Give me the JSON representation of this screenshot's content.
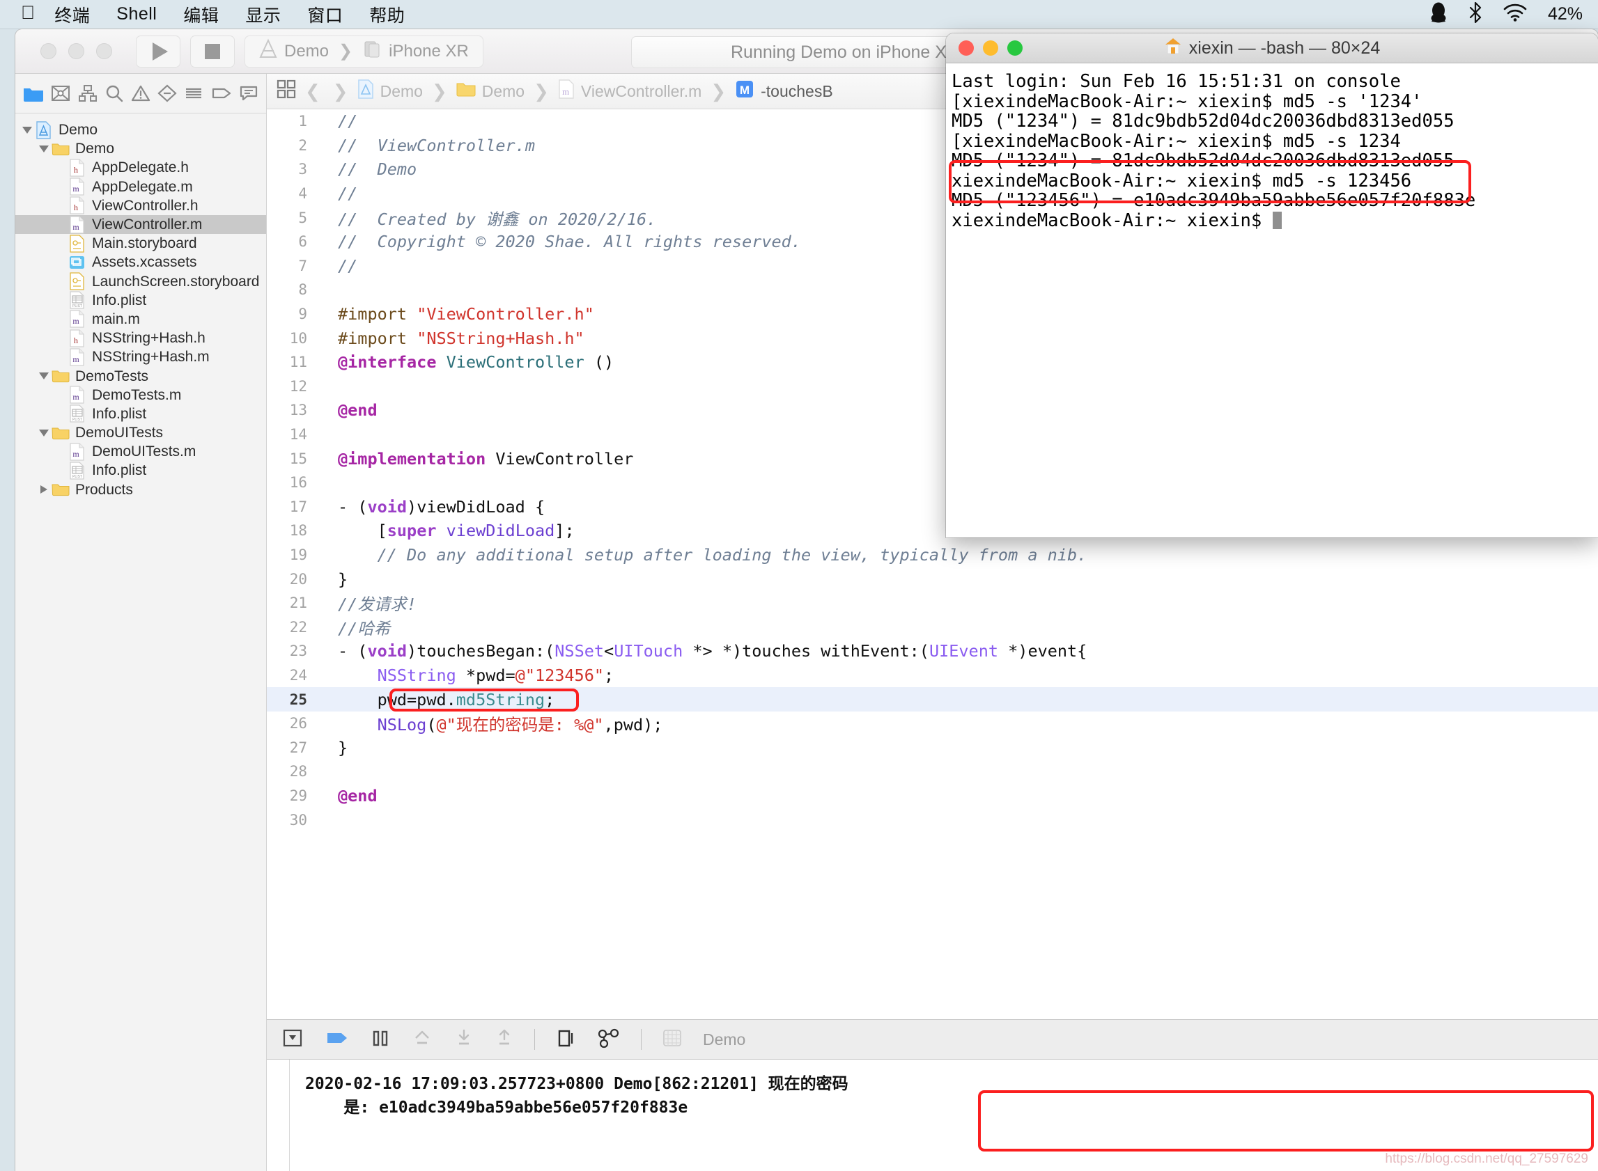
{
  "menubar": {
    "apple_icon": "apple-logo-icon",
    "items": [
      "终端",
      "Shell",
      "编辑",
      "显示",
      "窗口",
      "帮助"
    ],
    "right": {
      "qq_icon": "penguin-icon",
      "bluetooth_icon": "bluetooth-icon",
      "wifi_icon": "wifi-icon",
      "battery": "42%"
    }
  },
  "xcode": {
    "toolbar": {
      "run_icon": "play-icon",
      "stop_icon": "stop-icon",
      "scheme_app": "Demo",
      "scheme_device": "iPhone XR",
      "status": "Running Demo on iPhone XR"
    },
    "navigator": {
      "tabs": [
        "folder-icon",
        "warning-crossed-icon",
        "hierarchy-icon",
        "search-icon",
        "issue-warning-icon",
        "minus-diamond-icon",
        "list-icon",
        "tag-icon",
        "comment-icon"
      ],
      "tree": [
        {
          "label": "Demo",
          "indent": 0,
          "icon": "xcode-project-icon",
          "twisty": "open"
        },
        {
          "label": "Demo",
          "indent": 1,
          "icon": "folder-yellow-icon",
          "twisty": "open"
        },
        {
          "label": "AppDelegate.h",
          "indent": 2,
          "icon": "header-file-icon",
          "twisty": "none"
        },
        {
          "label": "AppDelegate.m",
          "indent": 2,
          "icon": "impl-file-icon",
          "twisty": "none"
        },
        {
          "label": "ViewController.h",
          "indent": 2,
          "icon": "header-file-icon",
          "twisty": "none"
        },
        {
          "label": "ViewController.m",
          "indent": 2,
          "icon": "impl-file-icon",
          "twisty": "none",
          "selected": true
        },
        {
          "label": "Main.storyboard",
          "indent": 2,
          "icon": "storyboard-icon",
          "twisty": "none"
        },
        {
          "label": "Assets.xcassets",
          "indent": 2,
          "icon": "assets-icon",
          "twisty": "none"
        },
        {
          "label": "LaunchScreen.storyboard",
          "indent": 2,
          "icon": "storyboard-icon",
          "twisty": "none"
        },
        {
          "label": "Info.plist",
          "indent": 2,
          "icon": "plist-icon",
          "twisty": "none"
        },
        {
          "label": "main.m",
          "indent": 2,
          "icon": "impl-file-icon",
          "twisty": "none"
        },
        {
          "label": "NSString+Hash.h",
          "indent": 2,
          "icon": "header-file-icon",
          "twisty": "none"
        },
        {
          "label": "NSString+Hash.m",
          "indent": 2,
          "icon": "impl-file-icon",
          "twisty": "none"
        },
        {
          "label": "DemoTests",
          "indent": 1,
          "icon": "folder-yellow-icon",
          "twisty": "open"
        },
        {
          "label": "DemoTests.m",
          "indent": 2,
          "icon": "impl-file-icon",
          "twisty": "none"
        },
        {
          "label": "Info.plist",
          "indent": 2,
          "icon": "plist-icon",
          "twisty": "none"
        },
        {
          "label": "DemoUITests",
          "indent": 1,
          "icon": "folder-yellow-icon",
          "twisty": "open"
        },
        {
          "label": "DemoUITests.m",
          "indent": 2,
          "icon": "impl-file-icon",
          "twisty": "none"
        },
        {
          "label": "Info.plist",
          "indent": 2,
          "icon": "plist-icon",
          "twisty": "none"
        },
        {
          "label": "Products",
          "indent": 1,
          "icon": "folder-yellow-icon",
          "twisty": "closed"
        }
      ]
    },
    "jumpbar": {
      "back_icon": "chevron-left-icon",
      "forward_icon": "chevron-right-icon",
      "crumbs": [
        "Demo",
        "Demo",
        "ViewController.m",
        "-touchesB"
      ]
    },
    "debugbar": {
      "icons": [
        "hide-console-icon",
        "continue-flag-icon",
        "pause-icon",
        "step-over-icon",
        "step-into-icon",
        "step-out-icon",
        "view-debug-icon",
        "memory-graph-icon",
        "grid-icon"
      ],
      "process_label": "Demo"
    },
    "console": {
      "line1": "2020-02-16 17:09:03.257723+0800 Demo[862:21201] 现在的密码",
      "line2": "    是: e10adc3949ba59abbe56e057f20f883e"
    },
    "watermark": "https://blog.csdn.net/qq_27597629"
  },
  "code": {
    "lines": [
      {
        "n": 1,
        "segments": [
          {
            "t": "//",
            "c": "cm"
          }
        ]
      },
      {
        "n": 2,
        "segments": [
          {
            "t": "//  ViewController.m",
            "c": "cm"
          }
        ]
      },
      {
        "n": 3,
        "segments": [
          {
            "t": "//  Demo",
            "c": "cm"
          }
        ]
      },
      {
        "n": 4,
        "segments": [
          {
            "t": "//",
            "c": "cm"
          }
        ]
      },
      {
        "n": 5,
        "segments": [
          {
            "t": "//  Created by 谢鑫 on 2020/2/16.",
            "c": "cm"
          }
        ]
      },
      {
        "n": 6,
        "segments": [
          {
            "t": "//  Copyright © 2020 Shae. All rights reserved.",
            "c": "cm"
          }
        ]
      },
      {
        "n": 7,
        "segments": [
          {
            "t": "//",
            "c": "cm"
          }
        ]
      },
      {
        "n": 8,
        "segments": []
      },
      {
        "n": 9,
        "segments": [
          {
            "t": "#import ",
            "c": "pre"
          },
          {
            "t": "\"ViewController.h\"",
            "c": "str"
          }
        ]
      },
      {
        "n": 10,
        "segments": [
          {
            "t": "#import ",
            "c": "pre"
          },
          {
            "t": "\"NSString+Hash.h\"",
            "c": "str"
          }
        ]
      },
      {
        "n": 11,
        "segments": [
          {
            "t": "@interface",
            "c": "kw"
          },
          {
            "t": " ",
            "c": "pl"
          },
          {
            "t": "ViewController",
            "c": "typ"
          },
          {
            "t": " ()",
            "c": "pl"
          }
        ]
      },
      {
        "n": 12,
        "segments": []
      },
      {
        "n": 13,
        "segments": [
          {
            "t": "@end",
            "c": "kw"
          }
        ]
      },
      {
        "n": 14,
        "segments": []
      },
      {
        "n": 15,
        "segments": [
          {
            "t": "@implementation",
            "c": "kw"
          },
          {
            "t": " ViewController",
            "c": "pl"
          }
        ]
      },
      {
        "n": 16,
        "segments": []
      },
      {
        "n": 17,
        "segments": [
          {
            "t": "- (",
            "c": "pl"
          },
          {
            "t": "void",
            "c": "kw2"
          },
          {
            "t": ")viewDidLoad {",
            "c": "pl"
          }
        ]
      },
      {
        "n": 18,
        "segments": [
          {
            "t": "    [",
            "c": "pl"
          },
          {
            "t": "super",
            "c": "kw2"
          },
          {
            "t": " ",
            "c": "pl"
          },
          {
            "t": "viewDidLoad",
            "c": "fn"
          },
          {
            "t": "];",
            "c": "pl"
          }
        ]
      },
      {
        "n": 19,
        "segments": [
          {
            "t": "    // Do any additional setup after loading the view, typically from a nib.",
            "c": "cm"
          }
        ]
      },
      {
        "n": 20,
        "segments": [
          {
            "t": "}",
            "c": "pl"
          }
        ]
      },
      {
        "n": 21,
        "segments": [
          {
            "t": "//发请求!",
            "c": "cm"
          }
        ]
      },
      {
        "n": 22,
        "segments": [
          {
            "t": "//哈希",
            "c": "cm"
          }
        ]
      },
      {
        "n": 23,
        "segments": [
          {
            "t": "- (",
            "c": "pl"
          },
          {
            "t": "void",
            "c": "kw2"
          },
          {
            "t": ")touchesBegan:(",
            "c": "pl"
          },
          {
            "t": "NSSet",
            "c": "typ2"
          },
          {
            "t": "<",
            "c": "pl"
          },
          {
            "t": "UITouch",
            "c": "typ2"
          },
          {
            "t": " *> *)touches withEvent:(",
            "c": "pl"
          },
          {
            "t": "UIEvent",
            "c": "typ2"
          },
          {
            "t": " *)event{",
            "c": "pl"
          }
        ]
      },
      {
        "n": 24,
        "segments": [
          {
            "t": "    ",
            "c": "pl"
          },
          {
            "t": "NSString",
            "c": "typ2"
          },
          {
            "t": " *pwd=",
            "c": "pl"
          },
          {
            "t": "@\"123456\"",
            "c": "str"
          },
          {
            "t": ";",
            "c": "pl"
          }
        ]
      },
      {
        "n": 25,
        "segments": [
          {
            "t": "    pwd=pwd.",
            "c": "pl"
          },
          {
            "t": "md5String",
            "c": "prop"
          },
          {
            "t": ";",
            "c": "pl"
          }
        ],
        "highlight": true
      },
      {
        "n": 26,
        "segments": [
          {
            "t": "    ",
            "c": "pl"
          },
          {
            "t": "NSLog",
            "c": "fn"
          },
          {
            "t": "(",
            "c": "pl"
          },
          {
            "t": "@\"现在的密码是: %@\"",
            "c": "str"
          },
          {
            "t": ",pwd);",
            "c": "pl"
          }
        ]
      },
      {
        "n": 27,
        "segments": [
          {
            "t": "}",
            "c": "pl"
          }
        ]
      },
      {
        "n": 28,
        "segments": []
      },
      {
        "n": 29,
        "segments": [
          {
            "t": "@end",
            "c": "kw"
          }
        ]
      },
      {
        "n": 30,
        "segments": []
      }
    ]
  },
  "terminal": {
    "title": "xiexin — -bash — 80×24",
    "home_icon": "home-folder-icon",
    "lines": [
      "Last login: Sun Feb 16 15:51:31 on console",
      "[xiexindeMacBook-Air:~ xiexin$ md5 -s '1234'",
      "MD5 (\"1234\") = 81dc9bdb52d04dc20036dbd8313ed055",
      "[xiexindeMacBook-Air:~ xiexin$ md5 -s 1234",
      "MD5 (\"1234\") = 81dc9bdb52d04dc20036dbd8313ed055",
      "xiexindeMacBook-Air:~ xiexin$ md5 -s 123456",
      "MD5 (\"123456\") = e10adc3949ba59abbe56e057f20f883e",
      "xiexindeMacBook-Air:~ xiexin$ "
    ]
  },
  "annotations": {
    "color": "#fb1f1f"
  }
}
